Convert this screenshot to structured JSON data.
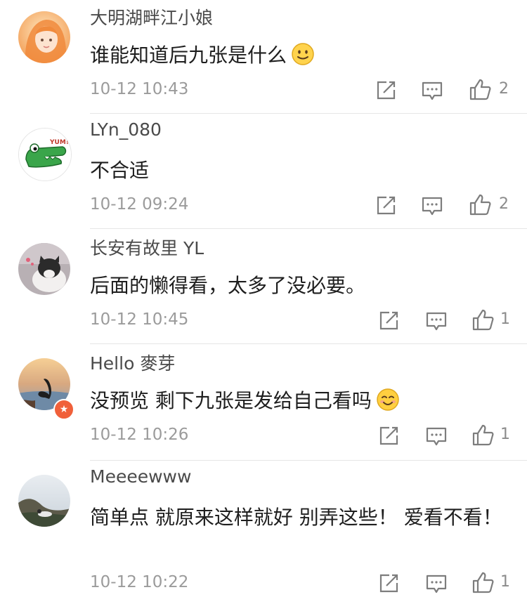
{
  "comments": [
    {
      "username": "大明湖畔江小娘",
      "text": "谁能知道后九张是什么",
      "emoji": "slight-smile-emoji",
      "time": "10-12 10:43",
      "likes": "2",
      "avatar": "orange-haired-girl-avatar"
    },
    {
      "username": "LYn_080",
      "text": "不合适",
      "emoji": "",
      "time": "10-12 09:24",
      "likes": "2",
      "avatar": "crocodile-yum-avatar",
      "avatar_text": "YUM!"
    },
    {
      "username": "长安有故里 YL",
      "text": "后面的懒得看，太多了没必要。",
      "emoji": "",
      "time": "10-12 10:45",
      "likes": "1",
      "avatar": "cat-avatar"
    },
    {
      "username": "Hello 麥芽",
      "text": "没预览 剩下九张是发给自己看吗",
      "emoji": "smiling-blush-emoji",
      "time": "10-12 10:26",
      "likes": "1",
      "avatar": "swan-lake-avatar"
    },
    {
      "username": "Meeeewww",
      "text": "简单点 就原来这样就好 别弄这些！ 爱看不看！",
      "emoji": "",
      "time": "10-12 10:22",
      "likes": "1",
      "avatar": "person-on-hill-avatar"
    }
  ],
  "icons": {
    "repost": "repost-icon",
    "comment": "comment-icon",
    "like": "thumbs-up-icon"
  },
  "colors": {
    "username": "#4a4a4a",
    "time": "#9b9b9b",
    "icon": "#7d7d7d",
    "badge": "#f0603a"
  }
}
